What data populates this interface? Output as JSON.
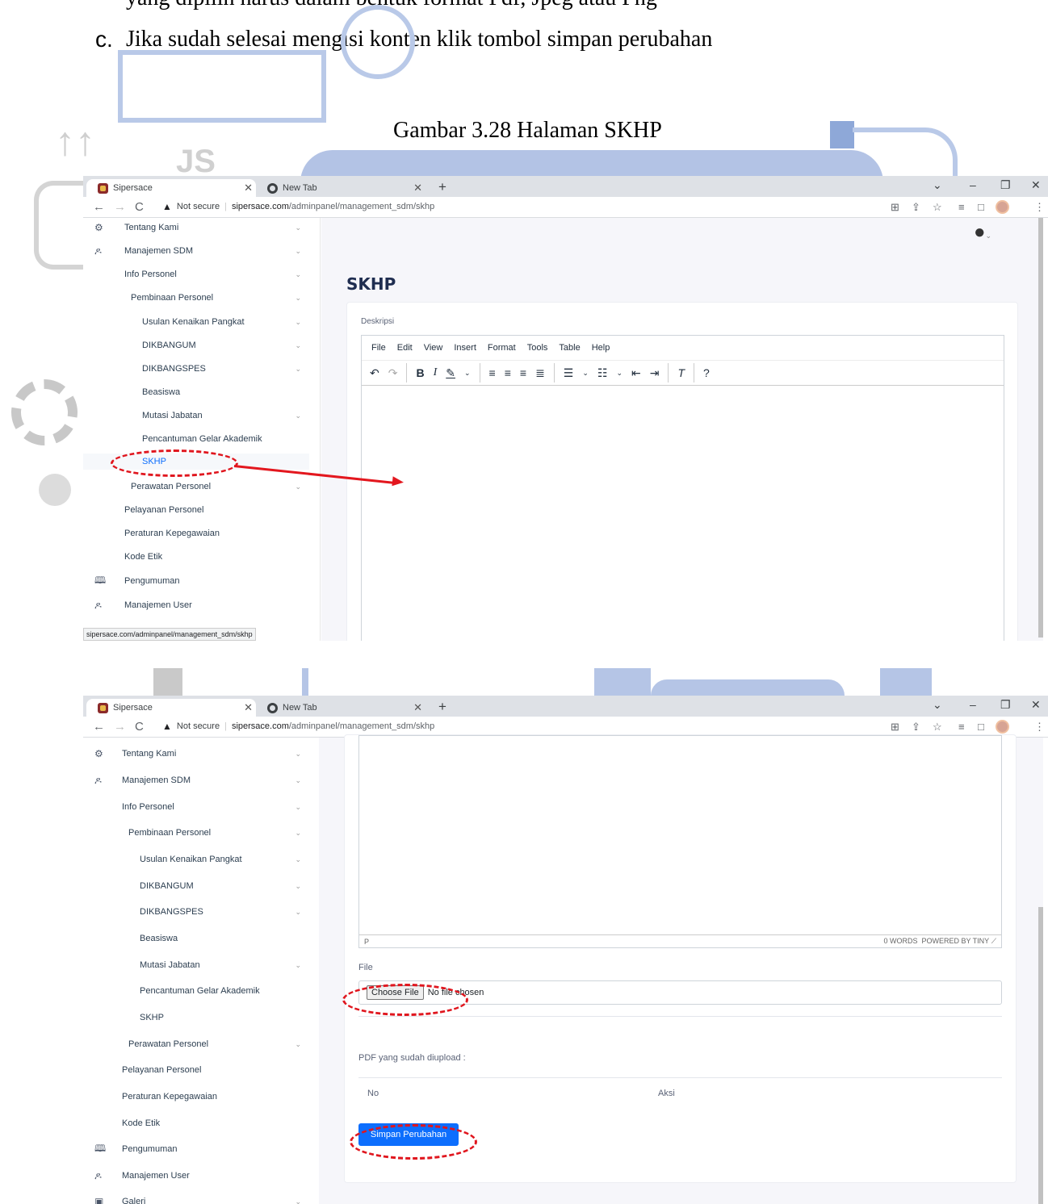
{
  "doc": {
    "top_line": "yang dipilih harus dalam bentuk format Pdf, Jpeg atau Png",
    "step_letter": "c.",
    "step_text": "Jika sudah selesai mengisi konten klik tombol simpan perubahan",
    "caption": "Gambar 3.28 Halaman SKHP",
    "watermark_letters": "JS"
  },
  "browser": {
    "tab1": "Sipersace",
    "tab2": "New Tab",
    "new_tab": "+",
    "not_secure": "Not secure",
    "url_domain": "sipersace.com",
    "url_path": "/adminpanel/management_sdm/skhp",
    "status_url": "sipersace.com/adminpanel/management_sdm/skhp"
  },
  "sidebar": {
    "items": [
      {
        "label": "Tentang Kami"
      },
      {
        "label": "Manajemen SDM"
      },
      {
        "label": "Info Personel"
      },
      {
        "label": "Pembinaan Personel"
      },
      {
        "label": "Usulan Kenaikan Pangkat"
      },
      {
        "label": "DIKBANGUM"
      },
      {
        "label": "DIKBANGSPES"
      },
      {
        "label": "Beasiswa"
      },
      {
        "label": "Mutasi Jabatan"
      },
      {
        "label": "Pencantuman Gelar Akademik"
      },
      {
        "label": "SKHP"
      },
      {
        "label": "Perawatan Personel"
      },
      {
        "label": "Pelayanan Personel"
      },
      {
        "label": "Peraturan Kepegawaian"
      },
      {
        "label": "Kode Etik"
      },
      {
        "label": "Pengumuman"
      },
      {
        "label": "Manajemen User"
      },
      {
        "label": "Galeri"
      }
    ]
  },
  "page": {
    "title": "SKHP",
    "desc_label": "Deskripsi",
    "file_label": "File",
    "choose_file": "Choose File",
    "no_file": "No file chosen",
    "uploaded_label": "PDF yang sudah diupload :",
    "col_no": "No",
    "col_aksi": "Aksi",
    "save_button": "Simpan Perubahan"
  },
  "editor": {
    "menu": [
      "File",
      "Edit",
      "View",
      "Insert",
      "Format",
      "Tools",
      "Table",
      "Help"
    ],
    "status_path": "P",
    "words": "0 WORDS",
    "powered": "POWERED BY TINY"
  }
}
